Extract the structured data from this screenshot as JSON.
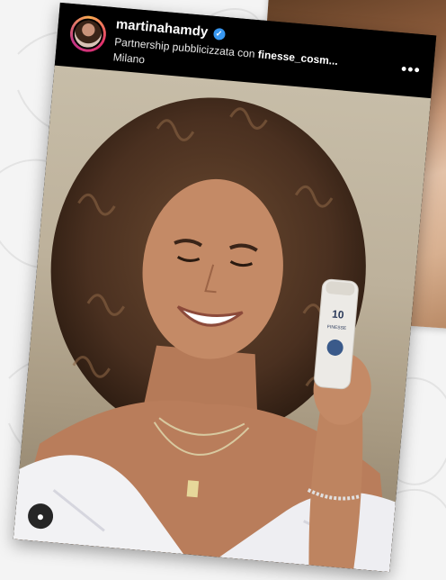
{
  "post": {
    "username": "martinahamdy",
    "partnership_prefix": "Partnership pubblicizzata con",
    "partner": "finesse_cosm...",
    "location": "Milano",
    "more_icon": "more-horizontal-icon",
    "tag_icon": "user-tag-icon"
  },
  "product": {
    "label_top": "10",
    "label_brand": "FINESSE"
  },
  "colors": {
    "header_bg": "#000000",
    "verified": "#3897f0",
    "avatar_ring": "#e1306c"
  }
}
